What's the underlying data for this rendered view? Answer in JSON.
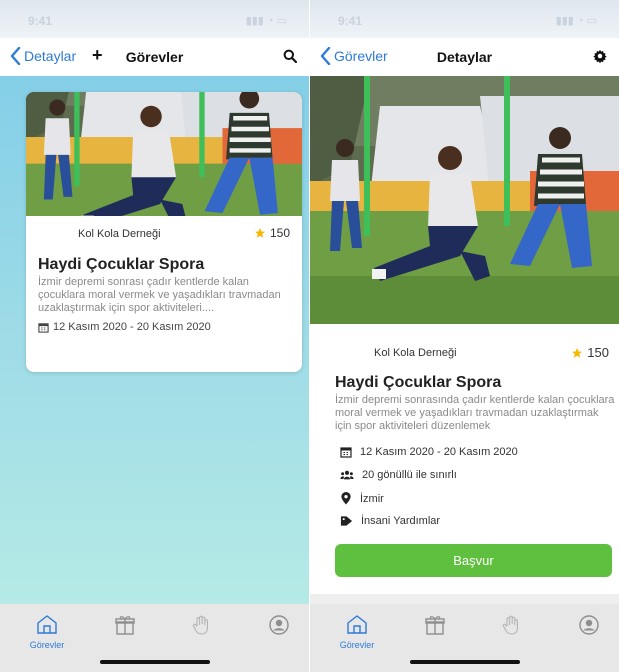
{
  "status": {
    "time": "9:41",
    "indicators": "▮▮▮ ◔ ▭"
  },
  "left": {
    "nav": {
      "back_label": "Detaylar",
      "add_symbol": "+",
      "title": "Görevler"
    },
    "card": {
      "organization": "Kol Kola Derneği",
      "points": "150",
      "title": "Haydi Çocuklar Spora",
      "description": "İzmir depremi sonrası çadır kentlerde kalan çocuklara moral vermek ve yaşadıkları travmadan uzaklaştırmak için spor aktiviteleri....",
      "date": "12 Kasım 2020 - 20 Kasım 2020"
    }
  },
  "right": {
    "nav": {
      "back_label": "Görevler",
      "title": "Detaylar"
    },
    "detail": {
      "organization": "Kol Kola Derneği",
      "points": "150",
      "title": "Haydi Çocuklar Spora",
      "description": "İzmir depremi sonrasında çadır kentlerde kalan çocuklara moral vermek ve yaşadıkları travmadan uzaklaştırmak için spor aktiviteleri düzenlemek",
      "date": "12 Kasım 2020 - 20 Kasım 2020",
      "volunteers": "20 gönüllü ile sınırlı",
      "location": "İzmir",
      "category": "İnsani Yardımlar",
      "apply_label": "Başvur"
    }
  },
  "tabbar": {
    "tasks_label": "Görevler",
    "active_color": "#2e7bd6",
    "inactive_color": "#8e8e8e"
  },
  "colors": {
    "accent": "#2e7bd6",
    "button_green": "#5ec03e",
    "star": "#f6b800"
  }
}
